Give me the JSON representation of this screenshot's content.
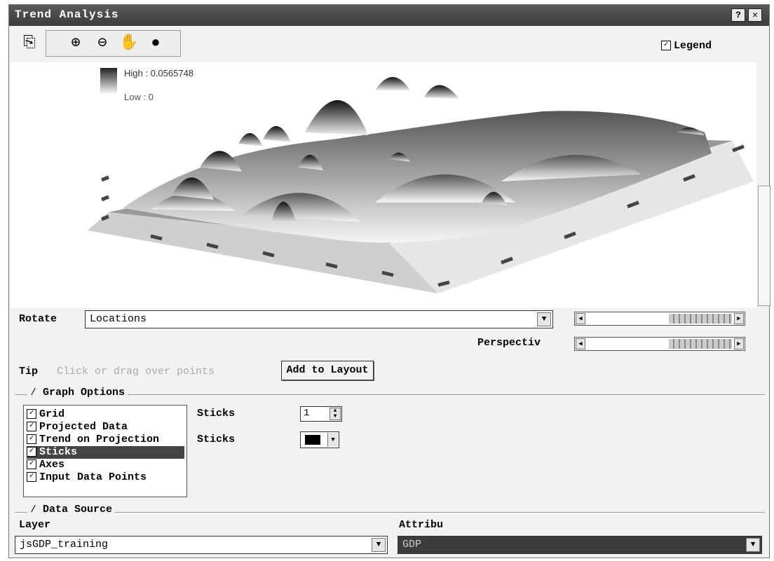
{
  "window": {
    "title": "Trend Analysis",
    "help_glyph": "?",
    "close_glyph": "✕"
  },
  "toolbar": {
    "tools": [
      {
        "name": "copy-to-layout-icon",
        "glyph": "⎘"
      },
      {
        "name": "zoom-in-icon",
        "glyph": "⊕"
      },
      {
        "name": "zoom-out-icon",
        "glyph": "⊖"
      },
      {
        "name": "pan-hand-icon",
        "glyph": "✋"
      },
      {
        "name": "full-extent-globe-icon",
        "glyph": "●"
      }
    ],
    "legend_label": "Legend",
    "legend_checked": true
  },
  "plot": {
    "legend_high": "High : 0.0565748",
    "legend_low": "Low : 0"
  },
  "rotate": {
    "label": "Rotate",
    "value": "Locations",
    "rotation_slider_level": 0.75
  },
  "perspective": {
    "label": "Perspectiv",
    "slider_level": 0.75
  },
  "tip": {
    "label": "Tip",
    "text": "Click or drag over points",
    "button_label": "Add to Layout"
  },
  "graph_options": {
    "label": "Graph Options",
    "items": [
      {
        "label": "Grid",
        "checked": true,
        "selected": false
      },
      {
        "label": "Projected Data",
        "checked": true,
        "selected": false
      },
      {
        "label": "Trend on Projection",
        "checked": true,
        "selected": false
      },
      {
        "label": "Sticks",
        "checked": true,
        "selected": true
      },
      {
        "label": "Axes",
        "checked": true,
        "selected": false
      },
      {
        "label": "Input Data Points",
        "checked": true,
        "selected": false
      }
    ],
    "sticks_size_label": "Sticks",
    "sticks_size_value": "1",
    "sticks_color_label": "Sticks",
    "sticks_color": "#000000"
  },
  "data_source": {
    "label": "Data Source",
    "layer_label": "Layer",
    "layer_value": "jsGDP_training",
    "attribute_label": "Attribu",
    "attribute_value": "GDP"
  }
}
